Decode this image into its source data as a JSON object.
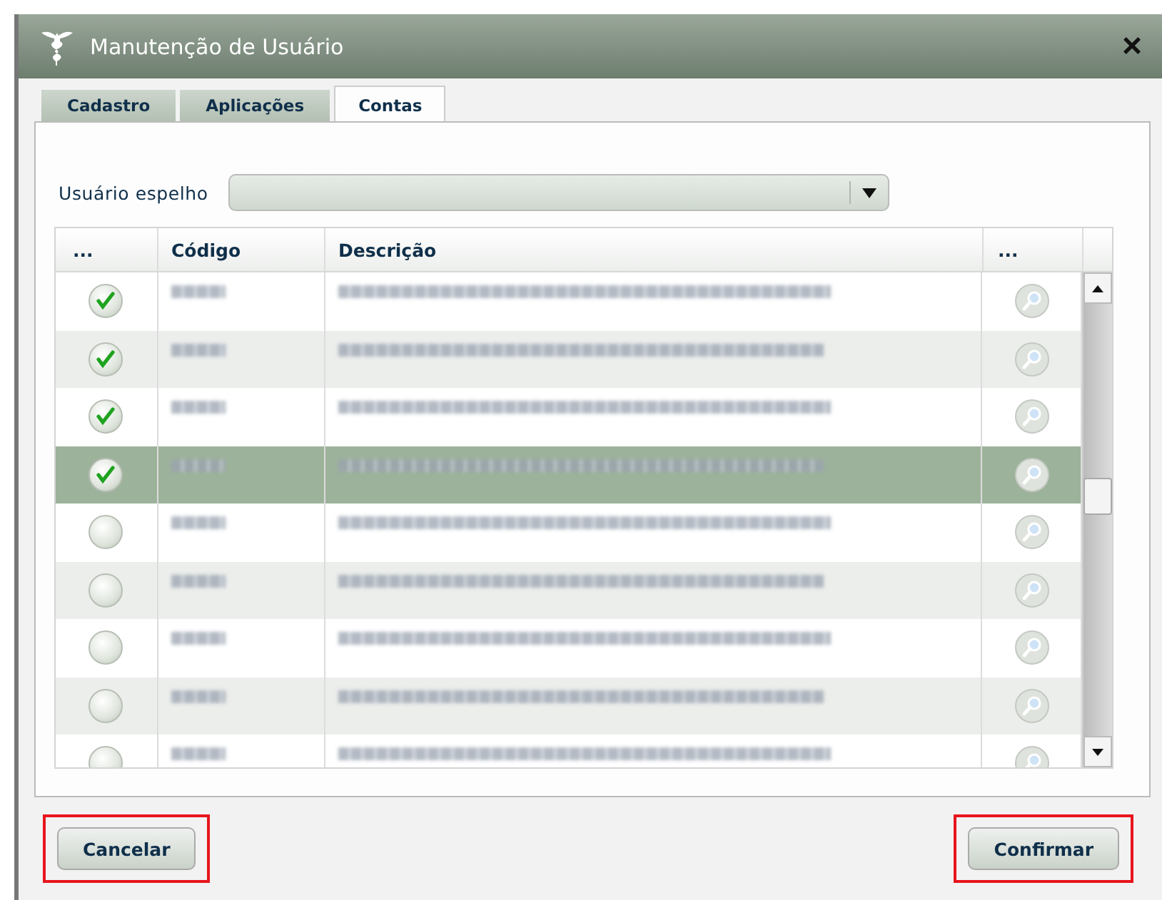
{
  "window": {
    "title": "Manutenção de Usuário",
    "close": "×"
  },
  "tabs": [
    {
      "label": "Cadastro",
      "selected": false
    },
    {
      "label": "Aplicações",
      "selected": false
    },
    {
      "label": "Contas",
      "selected": true
    }
  ],
  "mirror_user": {
    "label": "Usuário espelho"
  },
  "table": {
    "columns": [
      "...",
      "Código",
      "Descrição",
      "..."
    ],
    "rows": [
      {
        "checked": true,
        "selected": false
      },
      {
        "checked": true,
        "selected": false
      },
      {
        "checked": true,
        "selected": false
      },
      {
        "checked": true,
        "selected": true
      },
      {
        "checked": false,
        "selected": false
      },
      {
        "checked": false,
        "selected": false
      },
      {
        "checked": false,
        "selected": false
      },
      {
        "checked": false,
        "selected": false
      },
      {
        "checked": false,
        "selected": false
      }
    ]
  },
  "buttons": [
    {
      "label": "Cancelar",
      "highlighted": true
    },
    {
      "label": "Confirmar",
      "highlighted": true
    }
  ]
}
